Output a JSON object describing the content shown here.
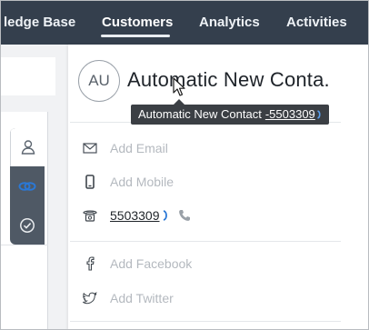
{
  "nav": {
    "items": [
      {
        "label": "ledge Base"
      },
      {
        "label": "Customers",
        "active": true
      },
      {
        "label": "Analytics"
      },
      {
        "label": "Activities"
      }
    ]
  },
  "contact": {
    "initials": "AU",
    "name": "Automatic New Conta.",
    "tooltip": {
      "name": "Automatic New Contact",
      "number": "-5503309"
    },
    "fields": {
      "email_placeholder": "Add Email",
      "mobile_placeholder": "Add Mobile",
      "phone_value": "5503309",
      "facebook_placeholder": "Add Facebook",
      "twitter_placeholder": "Add Twitter"
    }
  },
  "side_tabs": [
    {
      "icon": "person-icon",
      "active": true
    },
    {
      "icon": "link-icon",
      "active": false
    },
    {
      "icon": "check-circle-icon",
      "active": false
    }
  ],
  "colors": {
    "nav_bg": "#343f4d",
    "tab_bg": "#4f5965",
    "link_accent": "#2a78d6",
    "placeholder": "#b4b9bf"
  }
}
